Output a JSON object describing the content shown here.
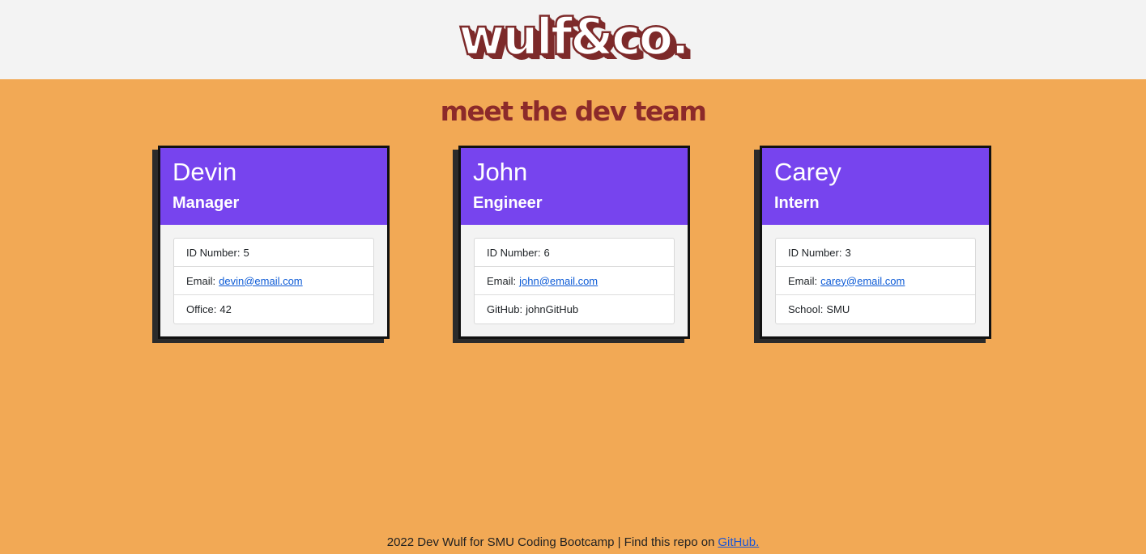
{
  "header": {
    "logo_text": "wulf&co."
  },
  "page_title": "meet the dev team",
  "team": [
    {
      "name": "Devin",
      "role": "Manager",
      "id_label": "ID Number:",
      "id_value": "5",
      "email_label": "Email:",
      "email": "devin@email.com",
      "extra_label": "Office:",
      "extra_value": "42"
    },
    {
      "name": "John",
      "role": "Engineer",
      "id_label": "ID Number:",
      "id_value": "6",
      "email_label": "Email:",
      "email": "john@email.com",
      "extra_label": "GitHub:",
      "extra_value": "johnGitHub"
    },
    {
      "name": "Carey",
      "role": "Intern",
      "id_label": "ID Number:",
      "id_value": "3",
      "email_label": "Email:",
      "email": "carey@email.com",
      "extra_label": "School:",
      "extra_value": "SMU"
    }
  ],
  "footer": {
    "text": "2022 Dev Wulf for SMU Coding Bootcamp | Find this repo on",
    "link_label": "GitHub."
  },
  "colors": {
    "page_background": "#f2a955",
    "header_background": "#f3f3f3",
    "brand_red": "#8c2a2a",
    "card_header": "#7744ee",
    "link": "#0d5bd6"
  }
}
